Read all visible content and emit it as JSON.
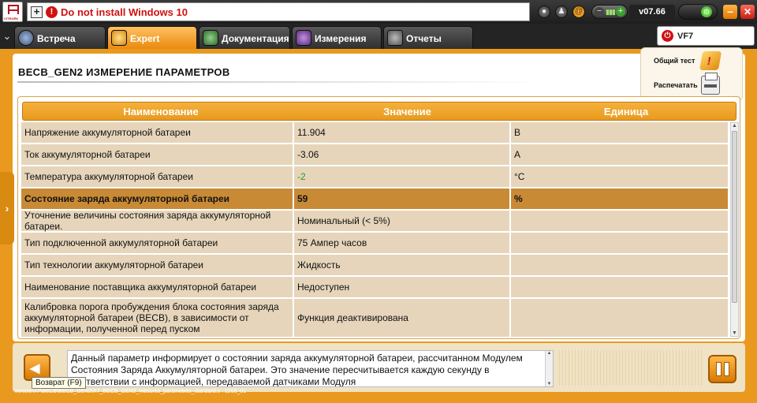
{
  "topbar": {
    "logo_text": "CITROËN",
    "message": "Do not install Windows 10",
    "version": "v07.66",
    "icons": [
      "record-icon",
      "user-icon",
      "at-icon",
      "mute-icon",
      "plus-icon",
      "network-icon",
      "minimize-icon",
      "close-icon"
    ]
  },
  "tabs": [
    {
      "label": "Встреча",
      "active": false
    },
    {
      "label": "Expert",
      "active": true
    },
    {
      "label": "Документация",
      "active": false
    },
    {
      "label": "Измерения",
      "active": false
    },
    {
      "label": "Отчеты",
      "active": false
    }
  ],
  "vehicle": {
    "label": "VF7"
  },
  "page": {
    "title": "BECB_GEN2  ИЗМЕРЕНИЕ ПАРАМЕТРОВ"
  },
  "actions": {
    "global_test": "Общий тест",
    "print": "Распечатать"
  },
  "table": {
    "headers": [
      "Наименование",
      "Значение",
      "Единица"
    ],
    "selected_row": 3,
    "rows": [
      {
        "name": "Напряжение аккумуляторной батареи",
        "value": "11.904",
        "unit": "В"
      },
      {
        "name": "Ток аккумуляторной батареи",
        "value": "-3.06",
        "unit": "А"
      },
      {
        "name": "Температура аккумуляторной батареи",
        "value": "-2",
        "unit": "°C"
      },
      {
        "name": "Состояние заряда аккумуляторной батареи",
        "value": "59",
        "unit": "%"
      },
      {
        "name": "Уточнение величины состояния заряда аккумуляторной батареи.",
        "value": "Номинальный (< 5%)",
        "unit": ""
      },
      {
        "name": "Тип подключенной аккумуляторной батареи",
        "value": "75 Ампер часов",
        "unit": ""
      },
      {
        "name": "Тип технологии аккумуляторной батареи",
        "value": "Жидкость",
        "unit": ""
      },
      {
        "name": "Наименование поставщика аккумуляторной батареи",
        "value": "Недоступен",
        "unit": ""
      },
      {
        "name": "Калибровка порога пробуждения блока состояния заряда аккумуляторной батареи (BECB), в зависимости от информации, полученной перед пуском",
        "value": "Функция деактивирована",
        "unit": ""
      }
    ],
    "value_colors": {
      "positive": "#2a9a18"
    }
  },
  "description": "Данный параметр информирует о состоянии заряда аккумуляторной батареи, рассчитанном Модулем Состояния Заряда Аккумуляторной батареи. Это значение пересчитывается каждую секунду в соответствии с информацией, передаваемой датчиками Модуля",
  "back_tooltip": "Возврат (F9)",
  "status_path": "Vehicle\\X7\\BECB\\BECB_GEN2\\X7_BECB_GEN2_mesures_parametres_standard.s : 1256_01",
  "colors": {
    "accent": "#e99a1e",
    "row_bg": "#e6d5bb",
    "row_selected": "#c98a36",
    "alert": "#d01010"
  }
}
